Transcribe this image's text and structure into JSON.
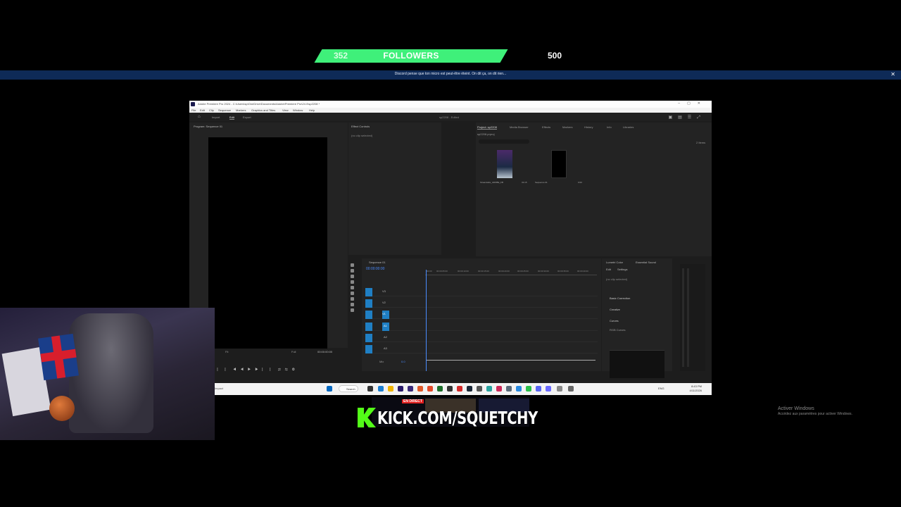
{
  "goal": {
    "current": "352",
    "label": "FOLLOWERS",
    "target": "500",
    "progress_fraction": 0.704,
    "color": "#3ff07a"
  },
  "banner": {
    "text": "Discord pense que ton micro est peut-être éteint. On dit ça, on dit rien...",
    "close_icon": "close-icon"
  },
  "premiere": {
    "title": "Adobe Premiere Pro 2024 - C:\\Users\\sp\\OneDrive\\Documents\\Adobe\\Premiere Pro\\24.0\\sp2208 *",
    "menu": [
      "File",
      "Edit",
      "Clip",
      "Sequence",
      "Markers",
      "Graphics and Titles",
      "View",
      "Window",
      "Help"
    ],
    "workspace_tabs": [
      "Import",
      "Edit",
      "Export"
    ],
    "active_workspace": "Edit",
    "project_center": "sp2208 - Edited",
    "program_monitor": {
      "title": "Program: Sequence 01",
      "fit": "Fit",
      "zoom": "Full",
      "timecode": "00:00:00:00"
    },
    "effect_controls": {
      "title": "Effect Controls",
      "placeholder": "(no clip selected)"
    },
    "project_panel": {
      "tabs": [
        "Project: sp2208",
        "Media Browser",
        "Effects",
        "Markers",
        "History",
        "Info",
        "Libraries"
      ],
      "path": "sp2208.prproj",
      "items_count": "2 Items",
      "items": [
        {
          "name": "Streamlabs_ADOBE_FB",
          "duration": "31:15"
        },
        {
          "name": "Sequence 01",
          "duration": "0:00"
        }
      ]
    },
    "timeline": {
      "title": "Sequence 01",
      "timecode": "00:00:00:00",
      "ruler": [
        "00:00",
        "00:00:05:00",
        "00:00:10:00",
        "00:00:15:00",
        "00:00:20:00",
        "00:00:25:00",
        "00:00:30:00",
        "00:00:35:00",
        "00:00:40:00"
      ],
      "video_tracks": [
        "V3",
        "V2",
        "V1"
      ],
      "audio_tracks": [
        "A1",
        "A2",
        "A3"
      ],
      "mix": "Mix",
      "mix_value": "0.0"
    },
    "lumetri": {
      "tabs": [
        "Lumetri Color",
        "Essential Sound"
      ],
      "sub_tabs": [
        "Edit",
        "Settings"
      ],
      "placeholder": "(no clip selected)",
      "sections": [
        "Basic Correction",
        "Creative",
        "Curves",
        "RGB Curves"
      ]
    }
  },
  "taskbar": {
    "left_text": "Impact",
    "search": "Search",
    "lang": "ENG",
    "time": "8:43 PM",
    "date": "4/11/2026",
    "accent": "#0067c0"
  },
  "kick": {
    "live_badge": "EN DIRECT",
    "url": "KICK.COM/SQUETCHY",
    "brand": "#53fc18"
  },
  "activate_windows": {
    "title": "Activer Windows",
    "subtitle": "Accédez aux paramètres pour activer Windows."
  }
}
